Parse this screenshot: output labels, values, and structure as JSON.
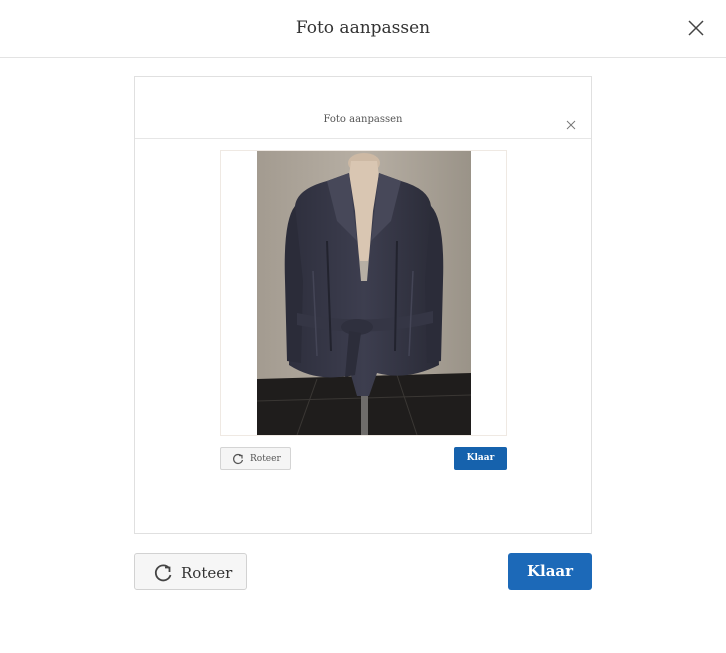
{
  "dialog": {
    "title": "Foto aanpassen",
    "close_icon": "close-icon"
  },
  "preview": {
    "title": "Foto aanpassen",
    "rotate_label": "Roteer",
    "done_label": "Klaar"
  },
  "footer": {
    "rotate_label": "Roteer",
    "rotate_icon": "rotate-icon",
    "done_label": "Klaar"
  },
  "colors": {
    "accent": "#1c69b8",
    "border": "#e3e3e3",
    "button_bg": "#f6f6f6"
  }
}
